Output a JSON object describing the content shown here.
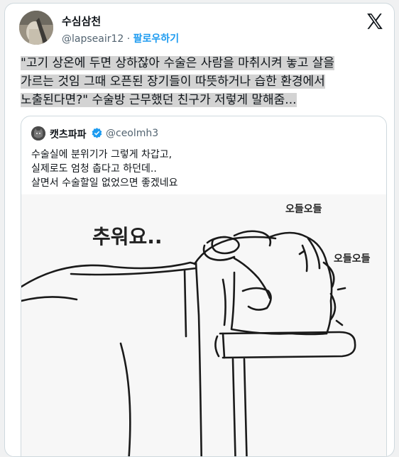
{
  "author": {
    "name": "수심삼천",
    "handle": "@lapseair12",
    "separator": "·",
    "follow_label": "팔로우하기"
  },
  "tweet": {
    "lines": [
      "\"고기 상온에 두면 상하잖아 수술은 사람을 마취시켜 놓고 살을",
      "가르는 것임 그때 오픈된 장기들이 따뜻하거나 습한 환경에서",
      "노출된다면?\"  수술방 근무했던 친구가 저렇게 말해줌..."
    ]
  },
  "quoted": {
    "name": "캣츠파파",
    "handle": "@ceolmh3",
    "lines": [
      "수술실에 분위기가 그렇게 차갑고,",
      "실제로도 엄청 춥다고 하던데..",
      "살면서 수술할일 없었으면 좋겠네요"
    ],
    "illustration": {
      "speech": "추워요..",
      "shiver_top": "오들오들",
      "shiver_side": "오들오들"
    }
  },
  "icons": {
    "brand": "x-logo-icon",
    "verified": "verified-badge-icon"
  },
  "colors": {
    "link": "#1d9bf0",
    "text": "#0f1419",
    "muted": "#536471",
    "highlight": "#d3d3d3"
  }
}
